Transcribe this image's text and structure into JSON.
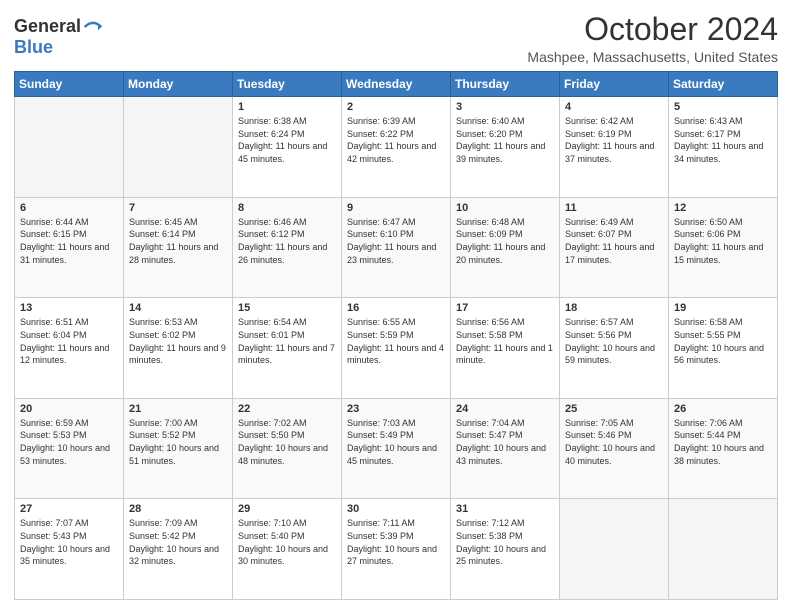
{
  "logo": {
    "general": "General",
    "blue": "Blue"
  },
  "header": {
    "month": "October 2024",
    "location": "Mashpee, Massachusetts, United States"
  },
  "days_of_week": [
    "Sunday",
    "Monday",
    "Tuesday",
    "Wednesday",
    "Thursday",
    "Friday",
    "Saturday"
  ],
  "weeks": [
    [
      {
        "day": "",
        "empty": true
      },
      {
        "day": "",
        "empty": true
      },
      {
        "day": "1",
        "sunrise": "Sunrise: 6:38 AM",
        "sunset": "Sunset: 6:24 PM",
        "daylight": "Daylight: 11 hours and 45 minutes."
      },
      {
        "day": "2",
        "sunrise": "Sunrise: 6:39 AM",
        "sunset": "Sunset: 6:22 PM",
        "daylight": "Daylight: 11 hours and 42 minutes."
      },
      {
        "day": "3",
        "sunrise": "Sunrise: 6:40 AM",
        "sunset": "Sunset: 6:20 PM",
        "daylight": "Daylight: 11 hours and 39 minutes."
      },
      {
        "day": "4",
        "sunrise": "Sunrise: 6:42 AM",
        "sunset": "Sunset: 6:19 PM",
        "daylight": "Daylight: 11 hours and 37 minutes."
      },
      {
        "day": "5",
        "sunrise": "Sunrise: 6:43 AM",
        "sunset": "Sunset: 6:17 PM",
        "daylight": "Daylight: 11 hours and 34 minutes."
      }
    ],
    [
      {
        "day": "6",
        "sunrise": "Sunrise: 6:44 AM",
        "sunset": "Sunset: 6:15 PM",
        "daylight": "Daylight: 11 hours and 31 minutes."
      },
      {
        "day": "7",
        "sunrise": "Sunrise: 6:45 AM",
        "sunset": "Sunset: 6:14 PM",
        "daylight": "Daylight: 11 hours and 28 minutes."
      },
      {
        "day": "8",
        "sunrise": "Sunrise: 6:46 AM",
        "sunset": "Sunset: 6:12 PM",
        "daylight": "Daylight: 11 hours and 26 minutes."
      },
      {
        "day": "9",
        "sunrise": "Sunrise: 6:47 AM",
        "sunset": "Sunset: 6:10 PM",
        "daylight": "Daylight: 11 hours and 23 minutes."
      },
      {
        "day": "10",
        "sunrise": "Sunrise: 6:48 AM",
        "sunset": "Sunset: 6:09 PM",
        "daylight": "Daylight: 11 hours and 20 minutes."
      },
      {
        "day": "11",
        "sunrise": "Sunrise: 6:49 AM",
        "sunset": "Sunset: 6:07 PM",
        "daylight": "Daylight: 11 hours and 17 minutes."
      },
      {
        "day": "12",
        "sunrise": "Sunrise: 6:50 AM",
        "sunset": "Sunset: 6:06 PM",
        "daylight": "Daylight: 11 hours and 15 minutes."
      }
    ],
    [
      {
        "day": "13",
        "sunrise": "Sunrise: 6:51 AM",
        "sunset": "Sunset: 6:04 PM",
        "daylight": "Daylight: 11 hours and 12 minutes."
      },
      {
        "day": "14",
        "sunrise": "Sunrise: 6:53 AM",
        "sunset": "Sunset: 6:02 PM",
        "daylight": "Daylight: 11 hours and 9 minutes."
      },
      {
        "day": "15",
        "sunrise": "Sunrise: 6:54 AM",
        "sunset": "Sunset: 6:01 PM",
        "daylight": "Daylight: 11 hours and 7 minutes."
      },
      {
        "day": "16",
        "sunrise": "Sunrise: 6:55 AM",
        "sunset": "Sunset: 5:59 PM",
        "daylight": "Daylight: 11 hours and 4 minutes."
      },
      {
        "day": "17",
        "sunrise": "Sunrise: 6:56 AM",
        "sunset": "Sunset: 5:58 PM",
        "daylight": "Daylight: 11 hours and 1 minute."
      },
      {
        "day": "18",
        "sunrise": "Sunrise: 6:57 AM",
        "sunset": "Sunset: 5:56 PM",
        "daylight": "Daylight: 10 hours and 59 minutes."
      },
      {
        "day": "19",
        "sunrise": "Sunrise: 6:58 AM",
        "sunset": "Sunset: 5:55 PM",
        "daylight": "Daylight: 10 hours and 56 minutes."
      }
    ],
    [
      {
        "day": "20",
        "sunrise": "Sunrise: 6:59 AM",
        "sunset": "Sunset: 5:53 PM",
        "daylight": "Daylight: 10 hours and 53 minutes."
      },
      {
        "day": "21",
        "sunrise": "Sunrise: 7:00 AM",
        "sunset": "Sunset: 5:52 PM",
        "daylight": "Daylight: 10 hours and 51 minutes."
      },
      {
        "day": "22",
        "sunrise": "Sunrise: 7:02 AM",
        "sunset": "Sunset: 5:50 PM",
        "daylight": "Daylight: 10 hours and 48 minutes."
      },
      {
        "day": "23",
        "sunrise": "Sunrise: 7:03 AM",
        "sunset": "Sunset: 5:49 PM",
        "daylight": "Daylight: 10 hours and 45 minutes."
      },
      {
        "day": "24",
        "sunrise": "Sunrise: 7:04 AM",
        "sunset": "Sunset: 5:47 PM",
        "daylight": "Daylight: 10 hours and 43 minutes."
      },
      {
        "day": "25",
        "sunrise": "Sunrise: 7:05 AM",
        "sunset": "Sunset: 5:46 PM",
        "daylight": "Daylight: 10 hours and 40 minutes."
      },
      {
        "day": "26",
        "sunrise": "Sunrise: 7:06 AM",
        "sunset": "Sunset: 5:44 PM",
        "daylight": "Daylight: 10 hours and 38 minutes."
      }
    ],
    [
      {
        "day": "27",
        "sunrise": "Sunrise: 7:07 AM",
        "sunset": "Sunset: 5:43 PM",
        "daylight": "Daylight: 10 hours and 35 minutes."
      },
      {
        "day": "28",
        "sunrise": "Sunrise: 7:09 AM",
        "sunset": "Sunset: 5:42 PM",
        "daylight": "Daylight: 10 hours and 32 minutes."
      },
      {
        "day": "29",
        "sunrise": "Sunrise: 7:10 AM",
        "sunset": "Sunset: 5:40 PM",
        "daylight": "Daylight: 10 hours and 30 minutes."
      },
      {
        "day": "30",
        "sunrise": "Sunrise: 7:11 AM",
        "sunset": "Sunset: 5:39 PM",
        "daylight": "Daylight: 10 hours and 27 minutes."
      },
      {
        "day": "31",
        "sunrise": "Sunrise: 7:12 AM",
        "sunset": "Sunset: 5:38 PM",
        "daylight": "Daylight: 10 hours and 25 minutes."
      },
      {
        "day": "",
        "empty": true
      },
      {
        "day": "",
        "empty": true
      }
    ]
  ]
}
